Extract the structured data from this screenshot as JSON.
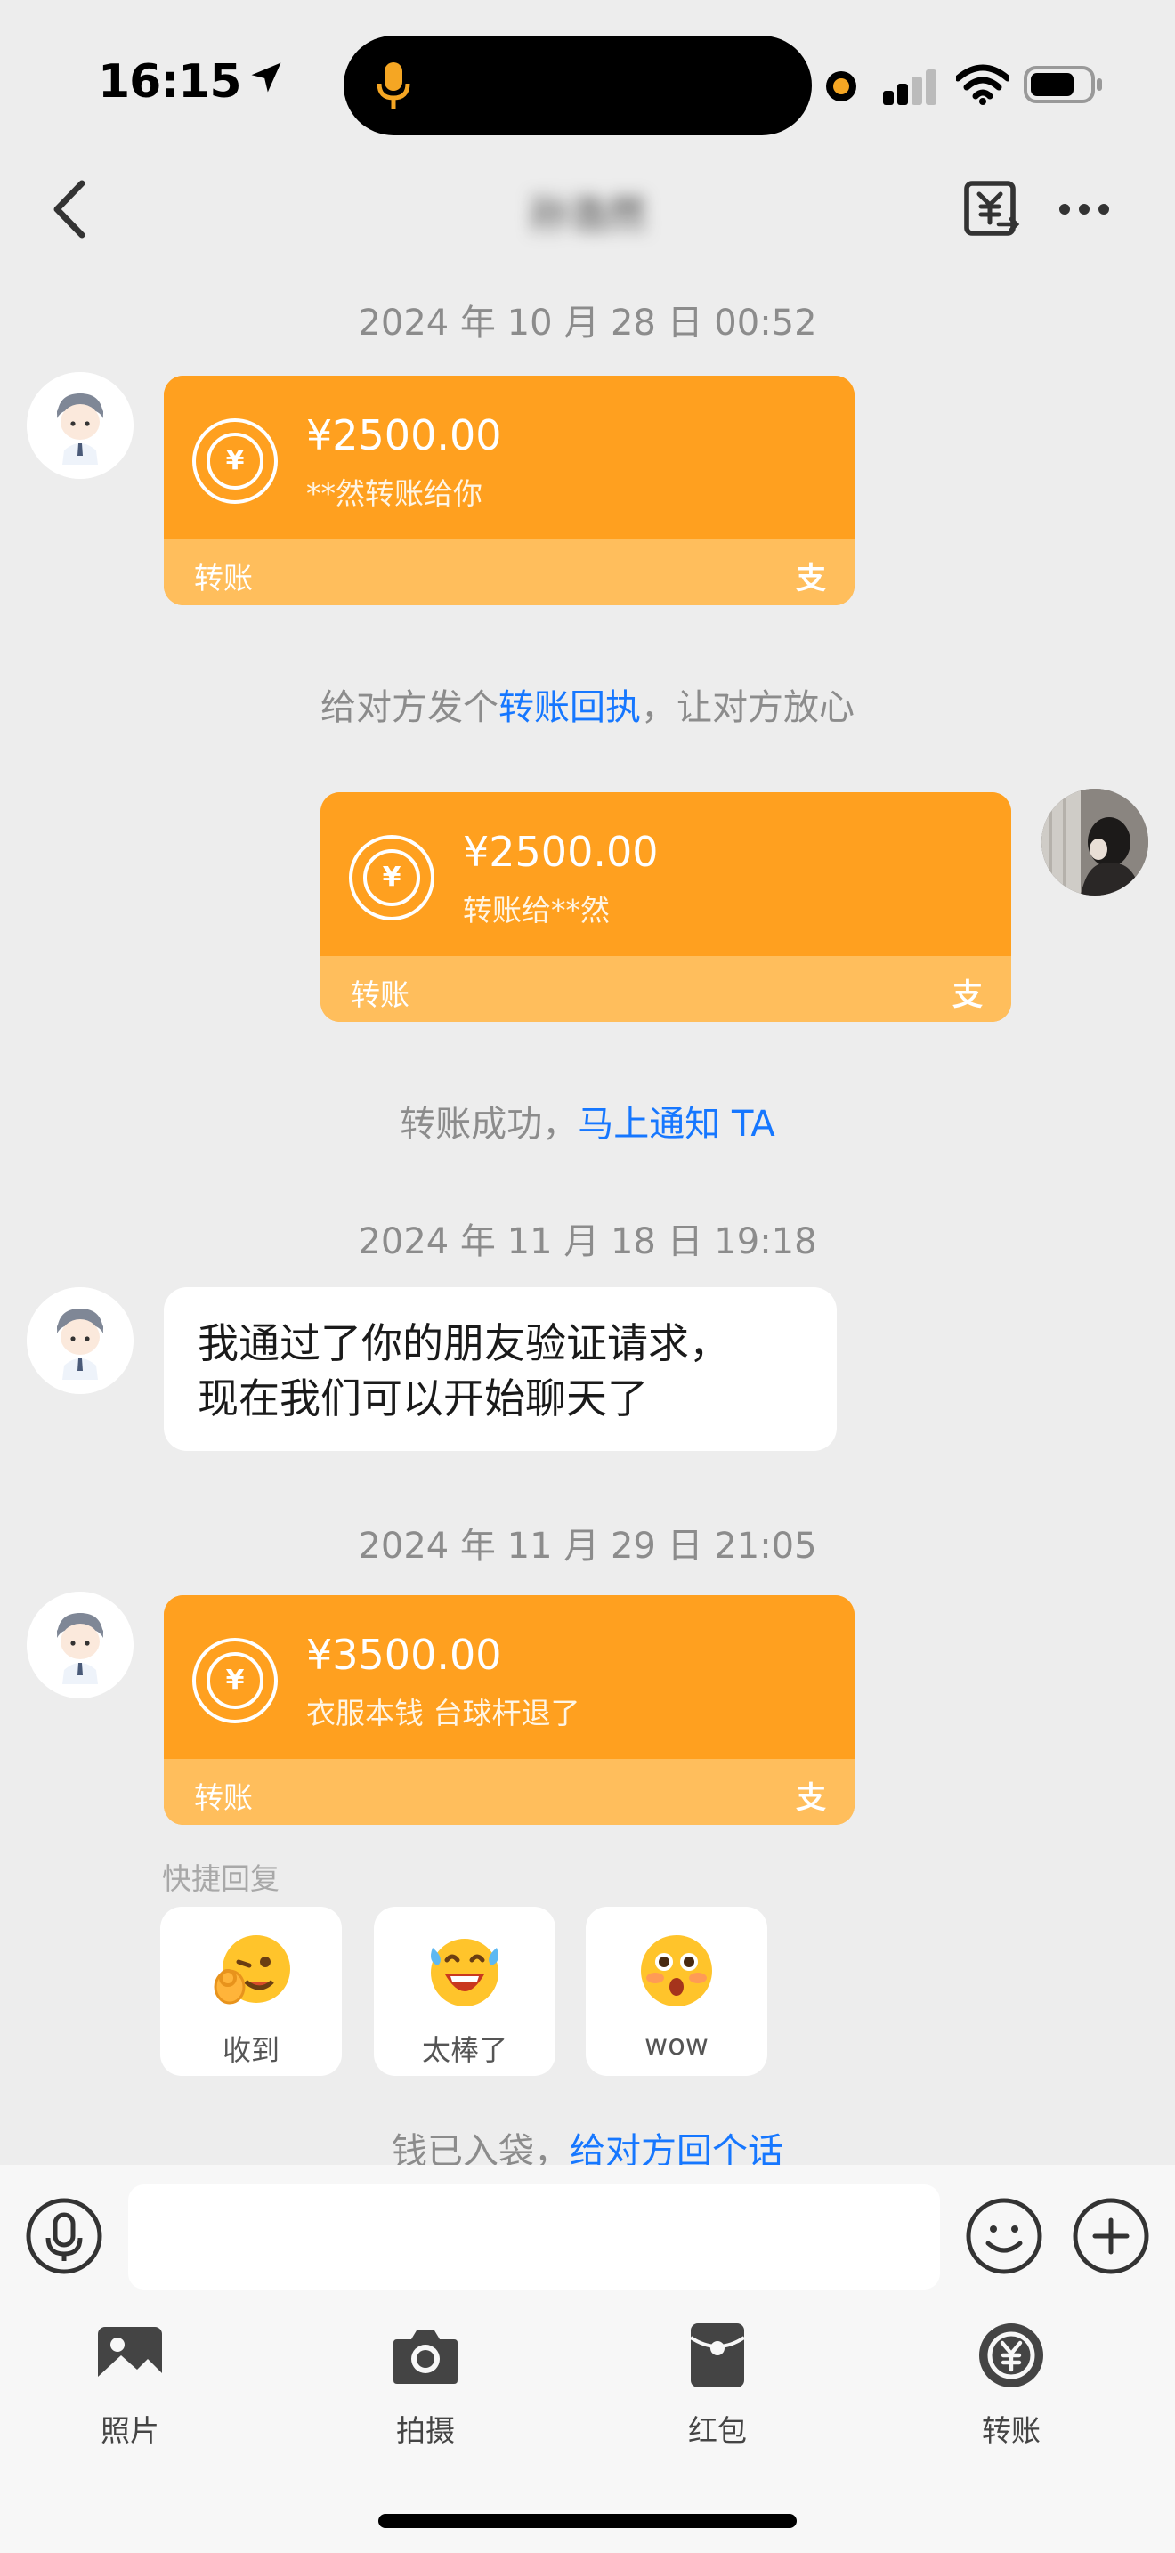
{
  "status_bar": {
    "time": "16:15"
  },
  "header": {
    "contact_name": "孙浩然"
  },
  "messages": [
    {
      "timestamp": "2024 年 10 月 28 日 00:52"
    },
    {
      "amount": "¥2500.00",
      "memo": "**然转账给你",
      "label": "转账",
      "pay_icon": "支"
    },
    {
      "hint_before": "给对方发个",
      "hint_link": "转账回执",
      "hint_after": "，让对方放心"
    },
    {
      "amount": "¥2500.00",
      "memo": "转账给**然",
      "label": "转账",
      "pay_icon": "支"
    },
    {
      "hint_before": "转账成功，",
      "hint_link": "马上通知 TA"
    },
    {
      "timestamp": "2024 年 11 月 18 日 19:18"
    },
    {
      "line1": "我通过了你的朋友验证请求，",
      "line2": "现在我们可以开始聊天了"
    },
    {
      "timestamp": "2024 年 11 月 29 日 21:05"
    },
    {
      "amount": "¥3500.00",
      "memo": "衣服本钱 台球杆退了",
      "label": "转账",
      "pay_icon": "支"
    },
    {
      "hint_before": "钱已入袋，",
      "hint_link": "给对方回个话"
    }
  ],
  "quick_reply": {
    "title": "快捷回复",
    "items": [
      {
        "label": "收到",
        "icon": "ok-hand-emoji-icon"
      },
      {
        "label": "太棒了",
        "icon": "tears-of-joy-emoji-icon"
      },
      {
        "label": "wow",
        "icon": "astonished-emoji-icon"
      }
    ]
  },
  "input": {
    "value": ""
  },
  "toolbar": {
    "photo": "照片",
    "camera": "拍摄",
    "red_packet": "红包",
    "transfer": "转账"
  },
  "colors": {
    "transfer_card": "#ffa01f",
    "transfer_card_footer": "#ffbe5c",
    "link": "#1677ff",
    "background": "#ededed"
  }
}
